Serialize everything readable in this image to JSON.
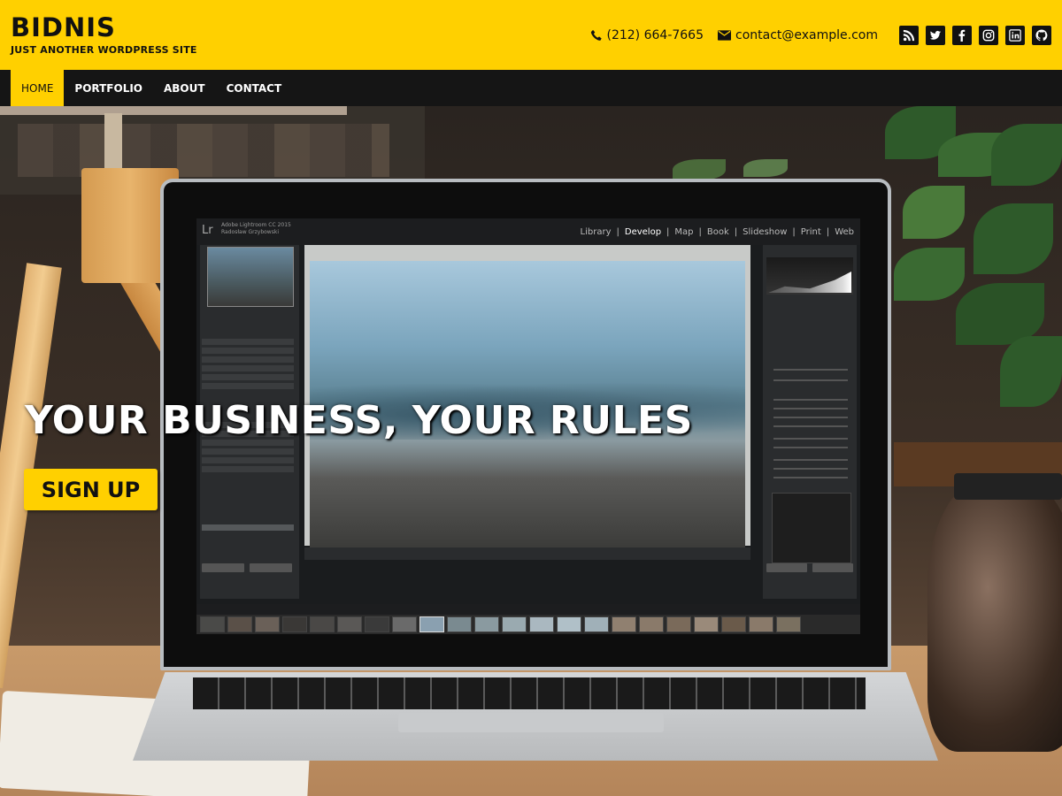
{
  "site": {
    "title": "BIDNIS",
    "tagline": "JUST ANOTHER WORDPRESS SITE"
  },
  "contact": {
    "phone": "(212) 664-7665",
    "email": "contact@example.com"
  },
  "social": [
    "rss-icon",
    "twitter-icon",
    "facebook-icon",
    "instagram-icon",
    "linkedin-icon",
    "github-icon"
  ],
  "nav": {
    "items": [
      {
        "label": "HOME",
        "active": true
      },
      {
        "label": "PORTFOLIO",
        "active": false
      },
      {
        "label": "ABOUT",
        "active": false
      },
      {
        "label": "CONTACT",
        "active": false
      }
    ]
  },
  "hero": {
    "title": "YOUR BUSINESS, YOUR RULES",
    "button_label": "SIGN UP"
  },
  "colors": {
    "accent": "#ffd000",
    "nav_bg": "#151515",
    "text_dark": "#111111"
  }
}
